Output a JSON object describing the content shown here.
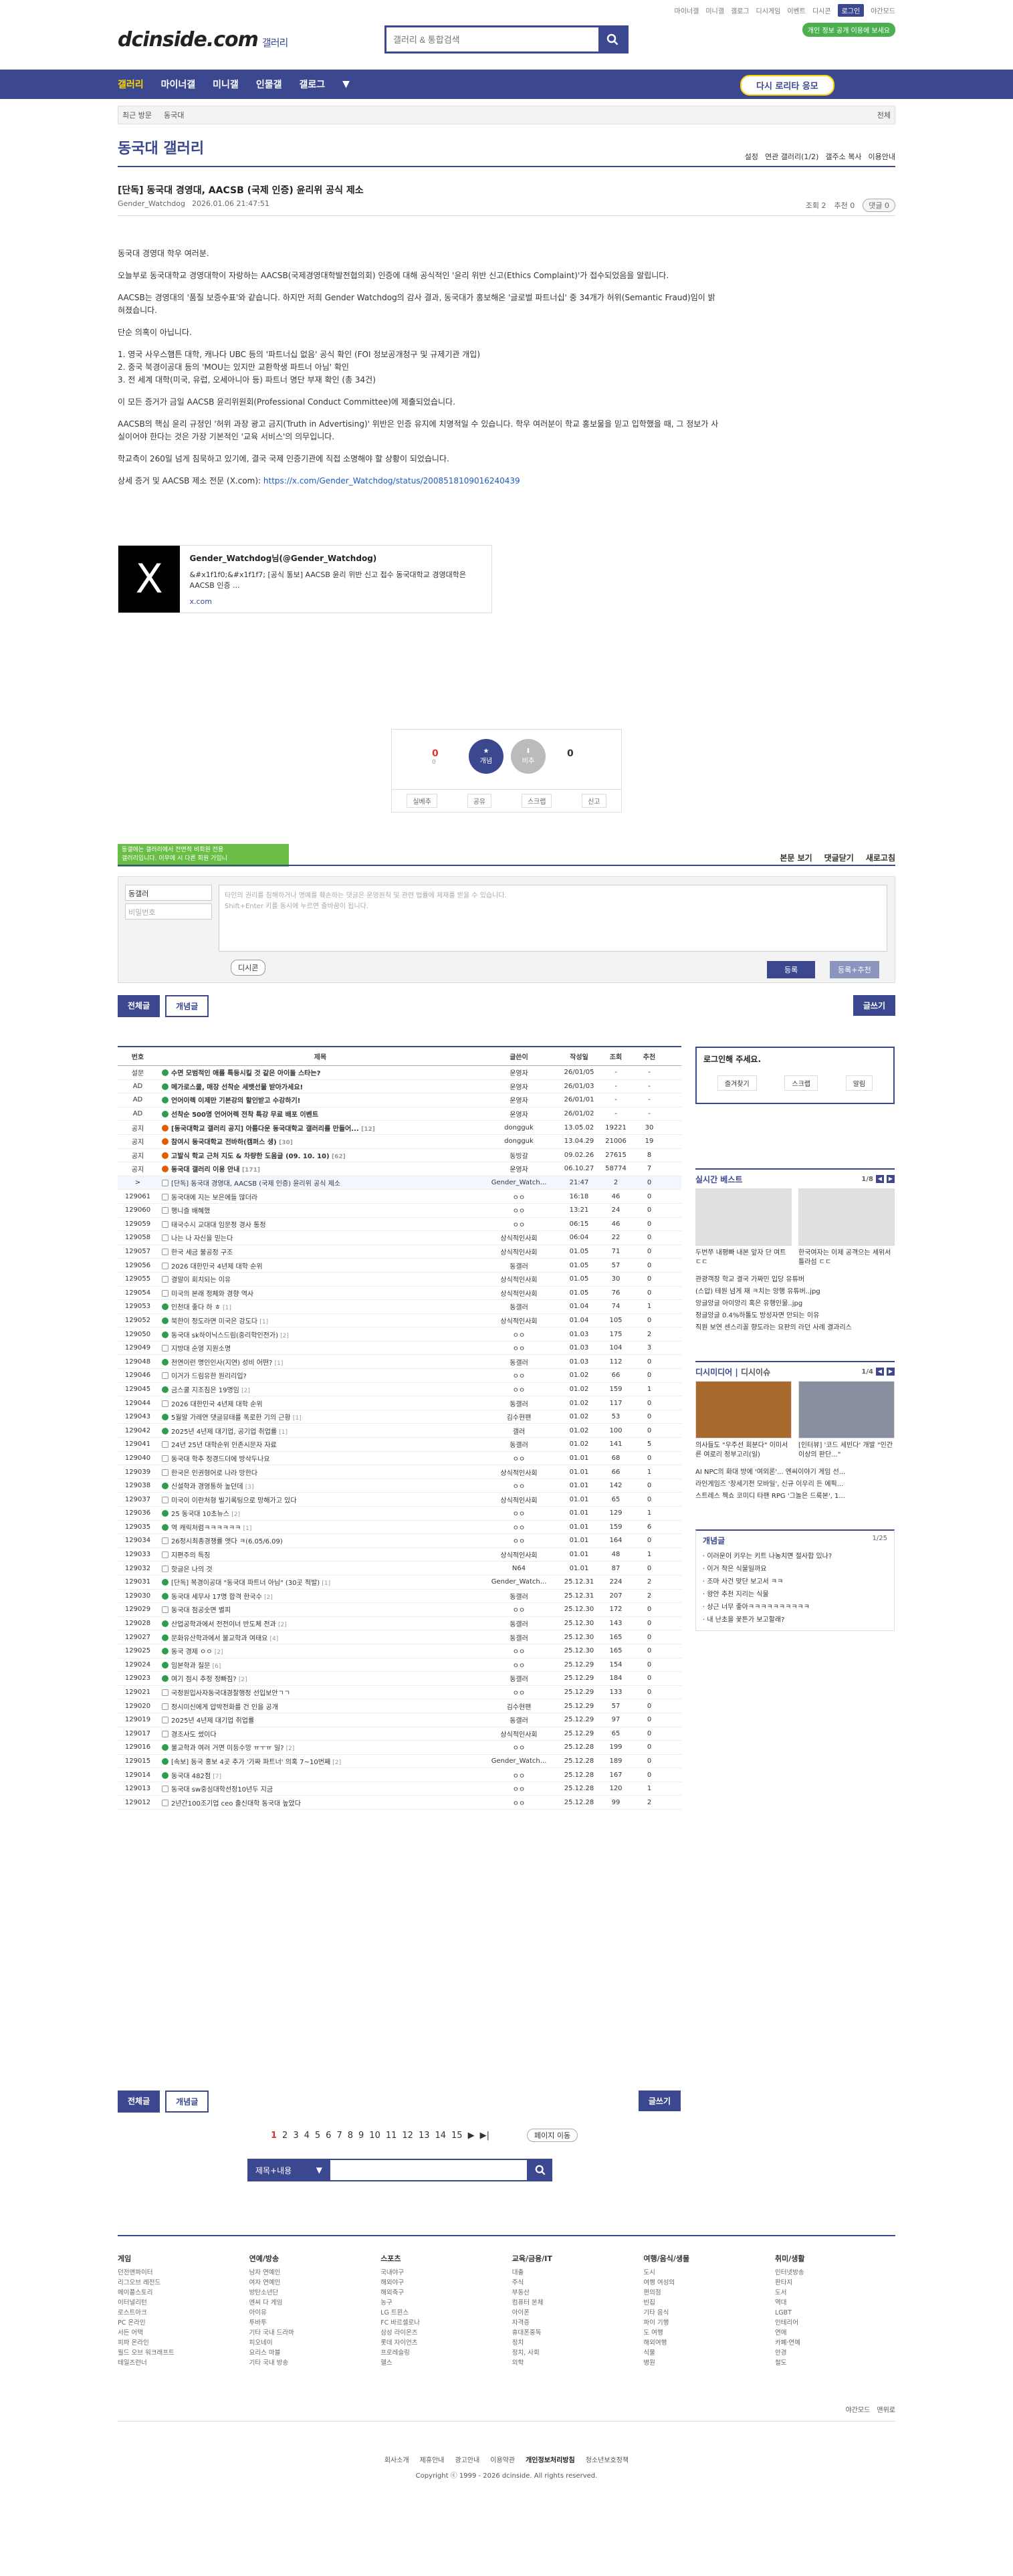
{
  "top": {
    "links": [
      "마이너갤",
      "미니갤",
      "갤로그",
      "디시게임",
      "이벤트",
      "디시콘"
    ],
    "login": "로그인",
    "nightmode": "야간모드"
  },
  "logo": {
    "main": "dcinside.com",
    "sub": "갤러리"
  },
  "search": {
    "placeholder": "갤러리 & 통합검색"
  },
  "promo": "개인 정보 공개 이용에 보세요",
  "gnb": {
    "items": [
      "갤러리",
      "마이너갤",
      "미니갤",
      "인물갤",
      "갤로그"
    ],
    "cta": "다시 로리타 응모"
  },
  "bread": {
    "items": [
      "최근 방문",
      "동국대"
    ],
    "right": "전체"
  },
  "gallery": {
    "title": "동국대 갤러리",
    "menu": [
      "설정",
      "연관 갤러리(1/2)",
      "갤주소 복사",
      "이용안내"
    ]
  },
  "post": {
    "title": "[단독] 동국대 경영대, AACSB (국제 인증) 윤리위 공식 제소",
    "author": "Gender_Watchdog",
    "date": "2026.01.06 21:47:51",
    "views": "조회 2",
    "recs": "추천 0",
    "comments": "댓글 0",
    "paragraphs": [
      "동국대 경영대 학우 여러분.",
      "오늘부로 동국대학교 경영대학이 자랑하는 AACSB(국제경영대학발전협의회) 인증에 대해 공식적인 '윤리 위반 신고(Ethics Complaint)'가 접수되었음을 알립니다.",
      "AACSB는 경영대의 '품질 보증수표'와 같습니다. 하지만 저희 Gender Watchdog의 감사 결과, 동국대가 홍보해온 '글로벌 파트너십' 중 34개가 허위(Semantic Fraud)임이 밝혀졌습니다.",
      "단순 의혹이 아닙니다.",
      "1. 영국 사우스햄튼 대학, 캐나다 UBC 등의 '파트너십 없음' 공식 확인 (FOI 정보공개청구 및 규제기관 개입)\n2. 중국 북경이공대 등의 'MOU는 있지만 교환학생 파트너 아님' 확인\n3. 전 세계 대학(미국, 유럽, 오세아니아 등) 파트너 명단 부재 확인 (총 34건)",
      "이 모든 증거가 금일 AACSB 윤리위원회(Professional Conduct Committee)에 제출되었습니다.",
      "AACSB의 핵심 윤리 규정인 '허위 과장 광고 금지(Truth in Advertising)' 위반은 인증 유지에 치명적일 수 있습니다. 학우 여러분이 학교 홍보물을 믿고 입학했을 때, 그 정보가 사실이어야 한다는 것은 가장 기본적인 '교육 서비스'의 의무입니다.",
      "학교측이 260일 넘게 침묵하고 있기에, 결국 국제 인증기관에 직접 소명해야 할 상황이 되었습니다."
    ],
    "evidence_label": "상세 증거 및 AACSB 제소 전문 (X.com): ",
    "evidence_link": "https://x.com/Gender_Watchdog/status/2008518109016240439"
  },
  "card": {
    "title": "Gender_Watchdog님(@Gender_Watchdog)",
    "desc": "&#x1f1f0;&#x1f1f7; [공식 통보] AACSB 윤리 위반 신고 접수 동국대학교 경영대학은 AACSB 인증 ...",
    "url": "x.com",
    "thumb": "X"
  },
  "recommend": {
    "up": "0",
    "up_sub": "0",
    "up_label": "개념",
    "down": "0",
    "down_label": "비추",
    "bar": [
      "실베추",
      "공유",
      "스크랩",
      "신고"
    ]
  },
  "tooltip": "동갤에는 갤러리에서 전면적 비회원 전용\n갤러리입니다. 이무에 시 다른 회원 가입니",
  "comments": {
    "tabs": [
      "본문 보기",
      "댓글닫기",
      "새로고침"
    ],
    "nick": "동갤러",
    "pw": "비밀번호",
    "placeholder": "타인의 권리를 침해하거나 명예를 훼손하는 댓글은 운영원칙 및 관련 법률에 제재를 받을 수 있습니다.\nShift+Enter 키를 동시에 누르면 줄바꿈이 됩니다.",
    "dccon": "디시콘",
    "reg": "등록",
    "reg2": "등록+추천"
  },
  "buttons": {
    "all": "전체글",
    "concept": "개념글",
    "write": "글쓰기"
  },
  "list": {
    "headers": [
      "번호",
      "제목",
      "글쓴이",
      "작성일",
      "조회",
      "추천"
    ],
    "rows": [
      [
        "설문",
        "수면 모범적인 애를 특등시킬 것 같은 아이돌 스타는?",
        "",
        "운영자",
        "26/01/05",
        "-",
        "-",
        "n"
      ],
      [
        "AD",
        "메가로스쿨, 매장 선착순 세뱃선물 받아가세요!",
        "",
        "운영자",
        "26/01/03",
        "-",
        "-",
        "n"
      ],
      [
        "AD",
        "언어이렉 이제만 기본강의 할인받고 수강하기!",
        "",
        "운영자",
        "26/01/01",
        "-",
        "-",
        "n"
      ],
      [
        "AD",
        "선착순 500명 언어어렉 전착 특강 무료 배포 이벤트",
        "",
        "운영자",
        "26/01/02",
        "-",
        "-",
        "n"
      ],
      [
        "공지",
        "[동국대학교 갤러리 공지] 아름다운 동국대학교 갤러리를 만들어...",
        "[12]",
        "dongguk",
        "13.05.02",
        "19221",
        "30",
        "n"
      ],
      [
        "공지",
        "참여시 동국대학교 전바하(캠퍼스 생)",
        "[30]",
        "dongguk",
        "13.04.29",
        "21006",
        "19",
        "n"
      ],
      [
        "공지",
        "고발식 학교 근처 지도 & 차량한 도움글 (09. 10. 10)",
        "[62]",
        "동빙갈",
        "09.02.26",
        "27615",
        "8",
        "n"
      ],
      [
        "공지",
        "동국대 갤러리 이용 안내",
        "[171]",
        "운영자",
        "06.10.27",
        "58774",
        "7",
        "n"
      ],
      [
        ">",
        "[단독] 동국대 경영대, AACSB (국제 인증) 윤리위 공식 제소",
        "",
        "Gender_Watch...",
        "21:47",
        "2",
        "0",
        "c"
      ],
      [
        "129061",
        "동국대에 지는 보은에들 많더라",
        "",
        "ㅇㅇ",
        "16:18",
        "46",
        "0",
        ""
      ],
      [
        "129060",
        "행니즐 배혜했",
        "",
        "ㅇㅇ",
        "13:21",
        "24",
        "0",
        ""
      ],
      [
        "129059",
        "태국수시 교대대 임문정 경사 통정",
        "",
        "ㅇㅇ",
        "06:15",
        "46",
        "0",
        ""
      ],
      [
        "129058",
        "나는 나 자신을 믿는다",
        "",
        "상식적인사회",
        "06:04",
        "22",
        "0",
        ""
      ],
      [
        "129057",
        "한국 세금 불공정 구조",
        "",
        "상식적인사회",
        "01.05",
        "71",
        "0",
        ""
      ],
      [
        "129056",
        "2026 대한민국 4년제 대학 순위",
        "",
        "동갤러",
        "01.05",
        "57",
        "0",
        ""
      ],
      [
        "129055",
        "결말이 회치되는 이유",
        "",
        "상식적인사회",
        "01.05",
        "30",
        "0",
        ""
      ],
      [
        "129054",
        "미국의 본래 정체와 경향 역사",
        "",
        "상식적인사회",
        "01.05",
        "76",
        "0",
        ""
      ],
      [
        "129053",
        "인천대 좋다 하 ㅎ",
        "[1]",
        "동갤러",
        "01.04",
        "74",
        "1",
        ""
      ],
      [
        "129052",
        "북한이 정도라면 미국은 강도다",
        "[1]",
        "상식적인사회",
        "01.04",
        "105",
        "0",
        ""
      ],
      [
        "129050",
        "동국대 sk하이닉스드림(중리학인전가)",
        "[2]",
        "ㅇㅇ",
        "01.03",
        "175",
        "2",
        ""
      ],
      [
        "129049",
        "지방대 순영 지원소명",
        "",
        "ㅇㅇ",
        "01.03",
        "104",
        "3",
        ""
      ],
      [
        "129048",
        "천연이런 명인인사(지연) 성비 어떤?",
        "[1]",
        "동갤러",
        "01.03",
        "112",
        "0",
        ""
      ],
      [
        "129046",
        "이거가 드림유한 원리리입?",
        "",
        "ㅇㅇ",
        "01.02",
        "66",
        "0",
        ""
      ],
      [
        "129045",
        "금스쿨 지조침은 19명임",
        "[2]",
        "ㅇㅇ",
        "01.02",
        "159",
        "1",
        ""
      ],
      [
        "129044",
        "2026 대한민국 4년제 대학 순위",
        "",
        "동갤러",
        "01.02",
        "117",
        "0",
        ""
      ],
      [
        "129043",
        "5월말 가레연 댓글뮤태를 폭로한 기의 근황",
        "[1]",
        "김수현팬",
        "01.02",
        "53",
        "0",
        ""
      ],
      [
        "129042",
        "2025년 4년제 대기업, 공기업 취업률",
        "[1]",
        "갤러",
        "01.02",
        "100",
        "0",
        ""
      ],
      [
        "129041",
        "24년 25년 대학순위 인존시문자 자료",
        "",
        "동갤러",
        "01.02",
        "141",
        "5",
        ""
      ],
      [
        "129040",
        "동국대 학추 정경드더에 방삭두나요",
        "",
        "ㅇㅇ",
        "01.01",
        "68",
        "0",
        ""
      ],
      [
        "129039",
        "한국은 인권형어로 나라 망한다",
        "",
        "상식적인사회",
        "01.01",
        "66",
        "1",
        ""
      ],
      [
        "129038",
        "신설학과 경영통하 높던데",
        "[3]",
        "ㅇㅇ",
        "01.01",
        "142",
        "0",
        ""
      ],
      [
        "129037",
        "미국이 이란처형 빌기록팅으로 망해가고 있다",
        "",
        "상식적인사회",
        "01.01",
        "65",
        "0",
        ""
      ],
      [
        "129036",
        "25 동국대 10초뉴스",
        "[2]",
        "ㅇㅇ",
        "01.01",
        "129",
        "1",
        ""
      ],
      [
        "129035",
        "역 캐릭처럼ㅋㅋㅋㅋㅋㅋ",
        "[1]",
        "ㅇㅇ",
        "01.01",
        "159",
        "6",
        ""
      ],
      [
        "129034",
        "26정시최종경쟁률 엣다 ㅋ(6.05/6.09)",
        "",
        "ㅇㅇ",
        "01.01",
        "164",
        "0",
        ""
      ],
      [
        "129033",
        "지편주의 특징",
        "",
        "상식적인사회",
        "01.01",
        "48",
        "1",
        ""
      ],
      [
        "129032",
        "핫글은 나의 것",
        "",
        "N64",
        "01.01",
        "87",
        "0",
        ""
      ],
      [
        "129031",
        "[단독] 복경이공대 \"동국대 파트너 아님\" (30곳 적발)",
        "[1]",
        "Gender_Watch...",
        "25.12.31",
        "224",
        "2",
        ""
      ],
      [
        "129030",
        "동국대 세무사 17명 합격 한국수",
        "[2]",
        "동갤러",
        "25.12.31",
        "207",
        "2",
        ""
      ],
      [
        "129029",
        "동국대 점공숫면 별피",
        "",
        "ㅇㅇ",
        "25.12.30",
        "172",
        "0",
        ""
      ],
      [
        "129028",
        "산업공학과에서 전전이너 반도체 전과",
        "[2]",
        "동갤러",
        "25.12.30",
        "143",
        "0",
        ""
      ],
      [
        "129027",
        "문화유산학과에서 불교학과 여태요",
        "[4]",
        "동갤러",
        "25.12.30",
        "165",
        "0",
        ""
      ],
      [
        "129025",
        "동국 경제 ㅇㅇ",
        "[2]",
        "ㅇㅇ",
        "25.12.30",
        "165",
        "0",
        ""
      ],
      [
        "129024",
        "임본학과 질문",
        "[6]",
        "ㅇㅇ",
        "25.12.29",
        "154",
        "0",
        ""
      ],
      [
        "129023",
        "여기 점시 추정 정빠짐?",
        "[2]",
        "동갤러",
        "25.12.29",
        "184",
        "0",
        ""
      ],
      [
        "129021",
        "국정원입사자동국대경찰행정 선입보안ㄱㄱ",
        "",
        "ㅇㅇ",
        "25.12.29",
        "133",
        "0",
        ""
      ],
      [
        "129020",
        "정시미신에게 압박전화를 건 인을 공개",
        "",
        "김수현팬",
        "25.12.29",
        "57",
        "0",
        ""
      ],
      [
        "129019",
        "2025년 4년제 대기업 취업률",
        "",
        "동갤러",
        "25.12.29",
        "97",
        "0",
        ""
      ],
      [
        "129017",
        "경조사도 썼이다",
        "",
        "상식적인사회",
        "25.12.29",
        "65",
        "0",
        ""
      ],
      [
        "129016",
        "불교학과 여러 거면 미등수망 ㅠㅜㅠ 일?",
        "[2]",
        "ㅇㅇ",
        "25.12.28",
        "199",
        "0",
        ""
      ],
      [
        "129015",
        "[속보] 동국 홍보 4곳 추가 '가짜 파트너' 의혹 7~10번째",
        "[2]",
        "Gender_Watch...",
        "25.12.28",
        "189",
        "0",
        ""
      ],
      [
        "129014",
        "동국대 482점",
        "[7]",
        "ㅇㅇ",
        "25.12.28",
        "167",
        "0",
        ""
      ],
      [
        "129013",
        "동국대 sw중심대학선정10년두 지금",
        "",
        "ㅇㅇ",
        "25.12.28",
        "120",
        "1",
        ""
      ],
      [
        "129012",
        "2년간100조기업 ceo 출신대학 동국대 높았다",
        "",
        "ㅇㅇ",
        "25.12.28",
        "99",
        "2",
        ""
      ]
    ]
  },
  "side": {
    "login_title": "로그인해 주세요.",
    "login_btns": [
      "즐겨찾기",
      "스크랩",
      "알림"
    ],
    "live": {
      "title": "실시간 베스트",
      "page": "1/8",
      "caps": [
        "두번쭈 내평빠 내본 앞자 단 여트 ㄷㄷ",
        "한국여자는 이제 공격으는 세위서 틀라섬 ㄷㄷ"
      ],
      "list": [
        "관광객장 학교 결국 가짜민 입당 유튜버",
        "(스압) 테원 넘게 재 ㅋ치는 앙행 유튜버..jpg",
        "앙글앙글 아이앙리 혹은 유행인물..jpg",
        "정글앙글 0.4%하톨도 방성자면 안되는 이유",
        "직원 보연 센스리꼴 향도라는 요판의 라던 사례 결과리스"
      ]
    },
    "dc": {
      "title": "디시미디어",
      "title2": "디시이슈",
      "page": "1/4",
      "caps": [
        "의사들도 \"우주선 회분다\" 이미서른 여로리 정부고리(일)",
        "[인터뷰] '코드 세빈다' 개발 \"인간 이상의 판단...\""
      ],
      "list": [
        "AI NPC의 화대 방에 '여외론'... 엔씨이야기 게임 선...",
        "라인게임즈 '창세기전 모바일', 신규 이우리 든 에픽...",
        "스트레스 젝쇼 코미디 타팬 RPG '그놀은 드룩본', 1..."
      ]
    },
    "concept": {
      "title": "개념글",
      "page": "1/25",
      "items": [
        "이러운이 키우는 키트 나농치면 절사합 있나?",
        "이거 작은 식물일까요",
        "조마 사건 맞단 보고서 ㅋㅋ",
        "왕안 추천 지리는 식물",
        "상근 너무 좋아ㅋㅋㅋㅋㅋㅋㅋㅋㅋㅋ",
        "내 난초을 꽃튼가 보고할래?"
      ]
    }
  },
  "paging": {
    "pages": [
      "1",
      "2",
      "3",
      "4",
      "5",
      "6",
      "7",
      "8",
      "9",
      "10",
      "11",
      "12",
      "13",
      "14",
      "15"
    ],
    "move": "페이지 이동"
  },
  "bsearch": {
    "select": "제목+내용"
  },
  "footer": {
    "cols": [
      {
        "title": "게임",
        "items": [
          "던전앤파이터",
          "리그오브 레전드",
          "메이플스토리",
          "이터널리턴",
          "로스트아크",
          "PC 온라인",
          "서든 어택",
          "피파 온라인",
          "월드 오브 워크래프트",
          "테일즈런너"
        ]
      },
      {
        "title": "연예/방송",
        "items": [
          "남자 연예인",
          "여자 연예인",
          "방탄소년단",
          "엔씨 다 게임",
          "아이유",
          "투바투",
          "기타 국내 드라마",
          "피오네이",
          "요리스 마블",
          "기타 국내 방송"
        ]
      },
      {
        "title": "스포츠",
        "items": [
          "국내야구",
          "해외야구",
          "해외축구",
          "농구",
          "LG 트윈스",
          "FC 바르셀로나",
          "삼성 라이온즈",
          "롯데 자이언츠",
          "프로레슬링",
          "헬스"
        ]
      },
      {
        "title": "교육/금융/IT",
        "items": [
          "대출",
          "주식",
          "부동산",
          "컴퓨터 본체",
          "아이폰",
          "자격증",
          "휴대폰중독",
          "정치",
          "정치, 사회",
          "의학"
        ]
      },
      {
        "title": "여행/음식/생물",
        "items": [
          "도시",
          "여행 여성의",
          "편의점",
          "빈집",
          "기타 음식",
          "파이 기행",
          "도 여행",
          "해외여행",
          "식물",
          "병원"
        ]
      },
      {
        "title": "취미/생활",
        "items": [
          "인터넷방송",
          "판타지",
          "도서",
          "역대",
          "LGBT",
          "인테리어",
          "연애",
          "카폐·연예",
          "안경",
          "철도"
        ]
      }
    ]
  },
  "footright": [
    "야간모드",
    "맨위로"
  ],
  "footlinks": [
    "회사소개",
    "제휴안내",
    "광고안내",
    "이용약관",
    "개인정보처리방침",
    "청소년보호정책"
  ],
  "copyright": "Copyright ⓒ 1999 - 2026 dcinside. All rights reserved."
}
